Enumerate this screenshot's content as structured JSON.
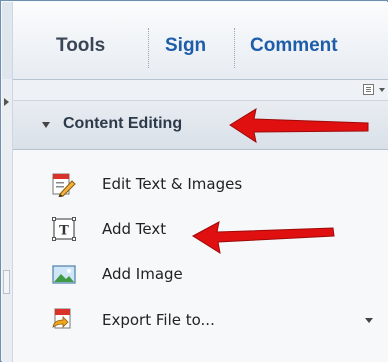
{
  "toolbar": {
    "tabs": [
      {
        "label": "Tools"
      },
      {
        "label": "Sign"
      },
      {
        "label": "Comment"
      }
    ]
  },
  "panel": {
    "options_icon": "panel-options-icon",
    "section": {
      "title": "Content Editing",
      "expanded": true
    },
    "items": [
      {
        "label": "Edit Text & Images",
        "icon": "edit-text-images-icon"
      },
      {
        "label": "Add Text",
        "icon": "add-text-icon"
      },
      {
        "label": "Add Image",
        "icon": "add-image-icon"
      },
      {
        "label": "Export File to...",
        "icon": "export-file-icon",
        "has_dropdown": true
      }
    ]
  },
  "colors": {
    "accent_tab": "#1f5da8",
    "annotation_arrow": "#e01010"
  }
}
